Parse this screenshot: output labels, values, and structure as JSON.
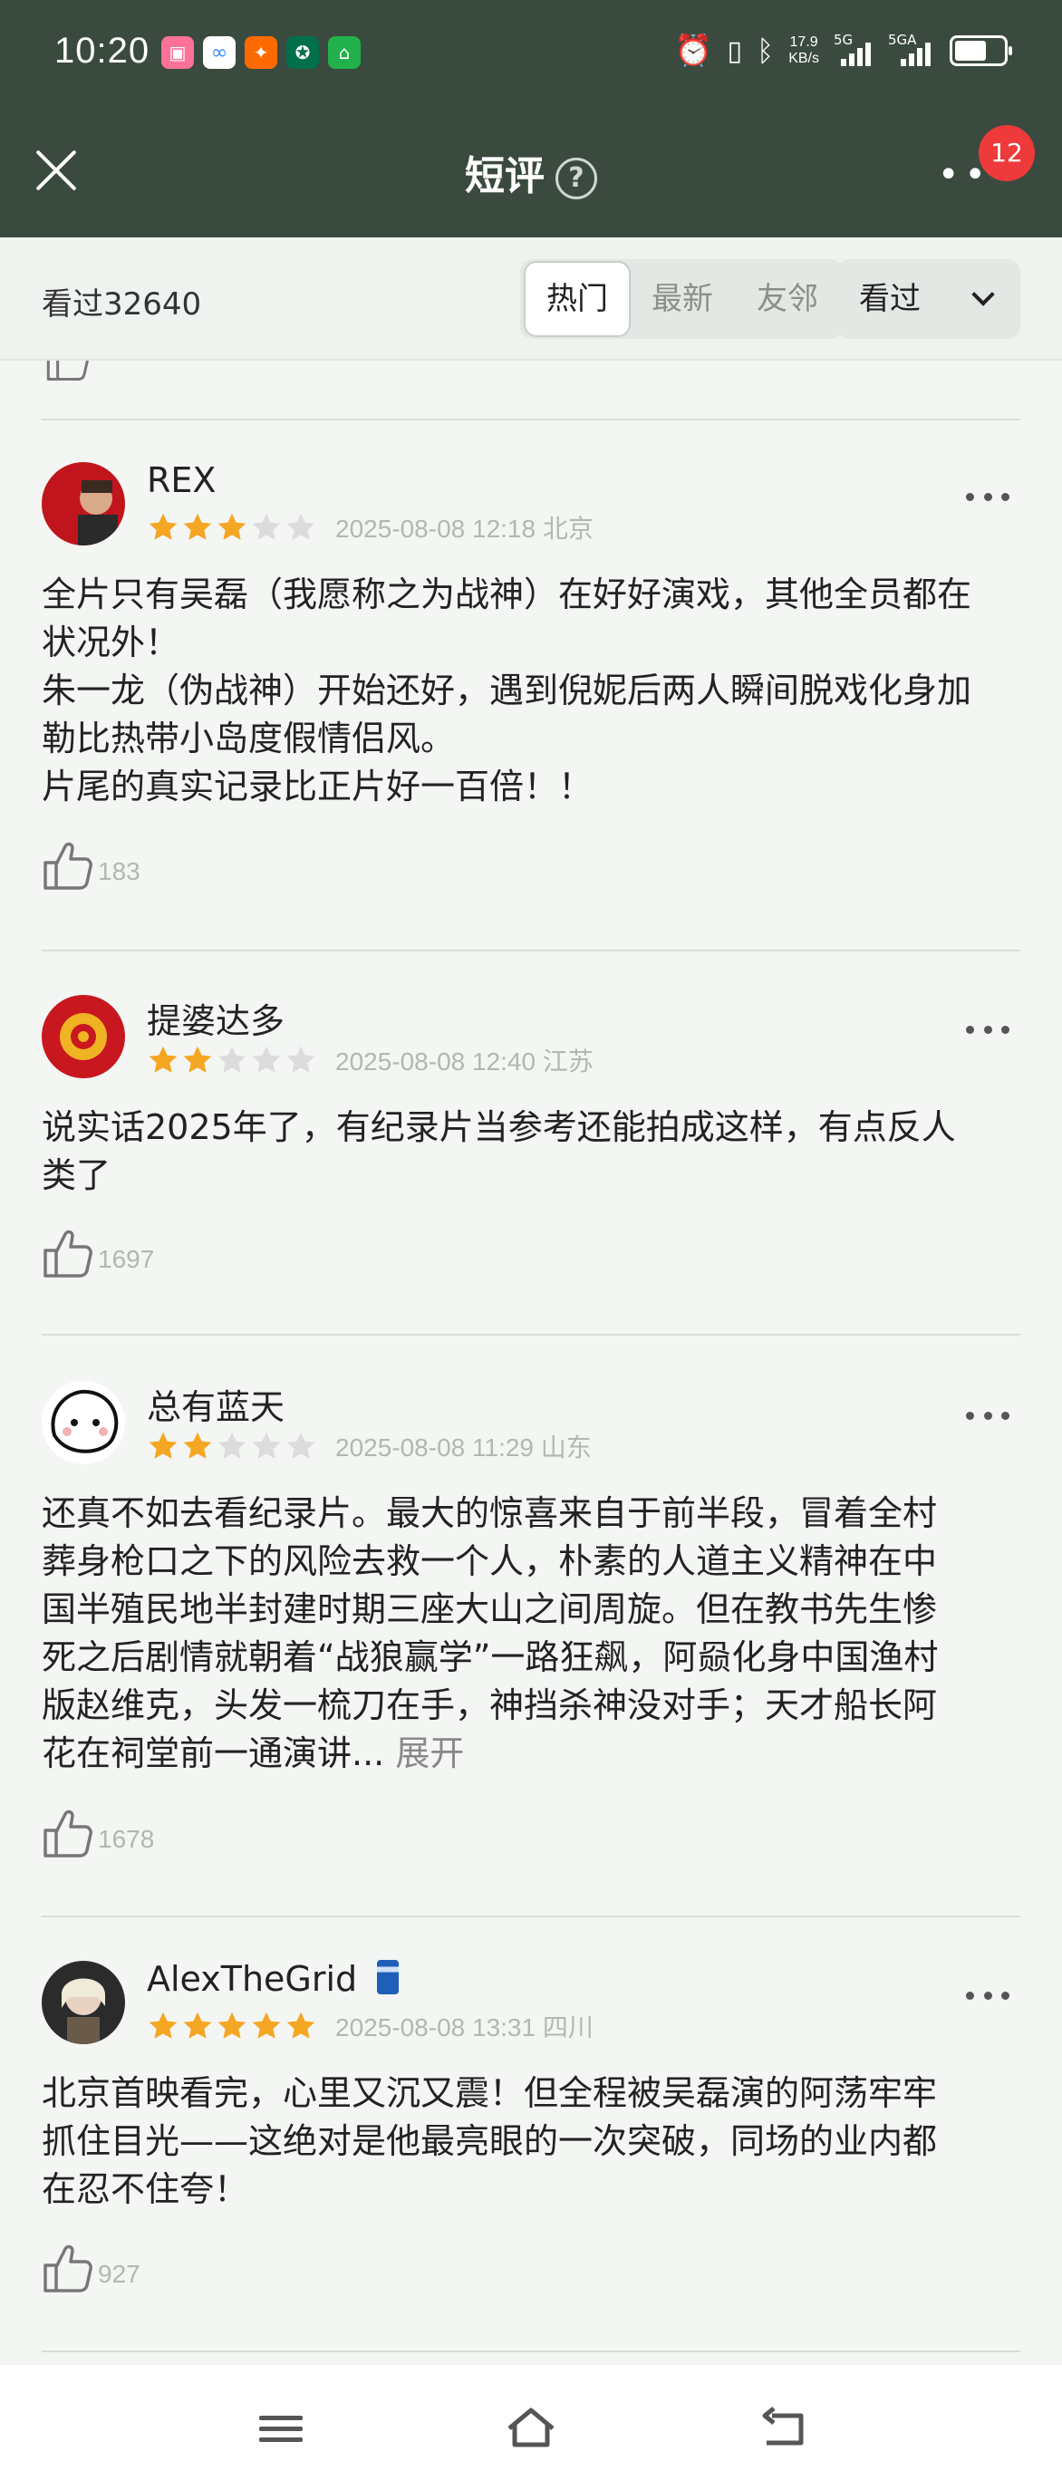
{
  "status_bar": {
    "time": "10:20",
    "net_speed_value": "17.9",
    "net_speed_unit": "KB/s",
    "signal1": "5G",
    "signal2": "5GA",
    "app_icons": [
      "bilibili-icon",
      "baidu-netdisk-icon",
      "taobao-icon",
      "starbucks-icon",
      "home-icon"
    ]
  },
  "header": {
    "title": "短评",
    "help_glyph": "?",
    "notification_count": "12"
  },
  "filter": {
    "watched_count": "看过32640",
    "tabs": [
      {
        "label": "热门",
        "active": true
      },
      {
        "label": "最新",
        "active": false
      },
      {
        "label": "友邻",
        "active": false
      }
    ],
    "dropdown_label": "看过"
  },
  "colors": {
    "header_bg": "#3b4a3f",
    "star_filled": "#f5a623",
    "star_empty": "#dcdcdc",
    "badge": "#ee3a3a"
  },
  "comments": [
    {
      "username": "REX",
      "rating": 3,
      "date": "2025-08-08 12:18",
      "location": "北京",
      "lines": [
        "全片只有吴磊（我愿称之为战神）在好好演戏，其他全员都在",
        "状况外！",
        "朱一龙（伪战神）开始还好，遇到倪妮后两人瞬间脱戏化身加",
        "勒比热带小岛度假情侣风。",
        "片尾的真实记录比正片好一百倍！！"
      ],
      "likes": "183"
    },
    {
      "username": "提婆达多",
      "rating": 2,
      "date": "2025-08-08 12:40",
      "location": "江苏",
      "lines": [
        "说实话2025年了，有纪录片当参考还能拍成这样，有点反人",
        "类了"
      ],
      "likes": "1697"
    },
    {
      "username": "总有蓝天",
      "rating": 2,
      "date": "2025-08-08 11:29",
      "location": "山东",
      "lines": [
        "还真不如去看纪录片。最大的惊喜来自于前半段，冒着全村",
        "葬身枪口之下的风险去救一个人，朴素的人道主义精神在中",
        "国半殖民地半封建时期三座大山之间周旋。但在教书先生惨",
        "死之后剧情就朝着“战狼赢学”一路狂飙，阿赑化身中国渔村",
        "版赵维克，头发一梳刀在手，神挡杀神没对手；天才船长阿",
        "花在祠堂前一通演讲..."
      ],
      "expand_label": "展开",
      "likes": "1678"
    },
    {
      "username": "AlexTheGrid",
      "badge_icon": "beer-can-icon",
      "rating": 5,
      "date": "2025-08-08 13:31",
      "location": "四川",
      "lines": [
        "北京首映看完，心里又沉又震！但全程被吴磊演的阿荡牢牢",
        "抓住目光——这绝对是他最亮眼的一次突破，同场的业内都",
        "在忍不住夸！"
      ],
      "likes": "927"
    }
  ],
  "nav": {
    "buttons": [
      "menu-icon",
      "home-icon",
      "back-icon"
    ]
  }
}
